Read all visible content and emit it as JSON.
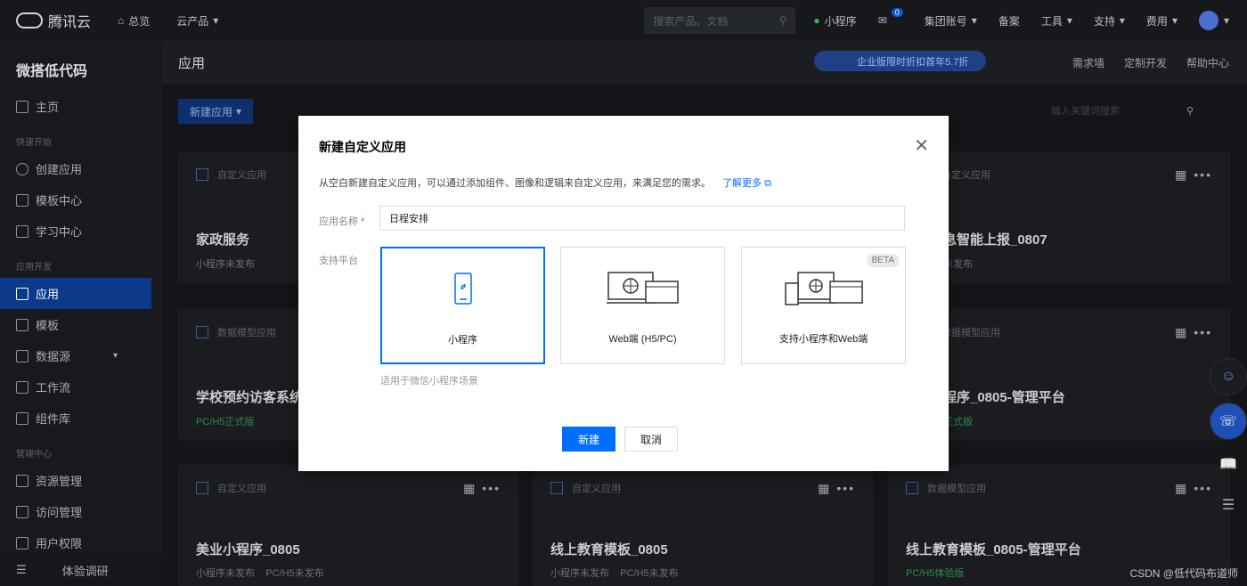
{
  "topbar": {
    "brand": "腾讯云",
    "overview": "总览",
    "products": "云产品",
    "search_placeholder": "搜索产品、文档",
    "mini_program": "小程序",
    "msg_count": "0",
    "account": "集团账号",
    "beian": "备案",
    "tools": "工具",
    "support": "支持",
    "cost": "费用"
  },
  "sidebar": {
    "title": "微搭低代码",
    "home": "主页",
    "group_quick": "快速开始",
    "create_app": "创建应用",
    "template_center": "模板中心",
    "learning": "学习中心",
    "group_app_dev": "应用开发",
    "apps": "应用",
    "templates": "模板",
    "datasource": "数据源",
    "workflow": "工作流",
    "components": "组件库",
    "group_manage": "管理中心",
    "resources": "资源管理",
    "access": "访问管理",
    "user_perm": "用户权限",
    "survey": "体验调研"
  },
  "main": {
    "title": "应用",
    "promo": "企业版限时折扣首年5.7折",
    "links": [
      "需求墙",
      "定制开发",
      "帮助中心"
    ],
    "new_app": "新建应用",
    "filter_placeholder": "输入关键词搜索"
  },
  "cards": [
    {
      "type": "自定义应用",
      "name": "家政服务",
      "status": "小程序未发布"
    },
    {
      "type": "自定义应用",
      "name": "息智能上报_0807",
      "status": "未发布"
    },
    {
      "type": "数据模型应用",
      "name": "学校预约访客系统",
      "status": "PC/H5正式版"
    },
    {
      "type": "数据模型应用",
      "name": "程序_0805-管理平台",
      "status": "正式版"
    },
    {
      "type": "自定义应用",
      "name": "美业小程序_0805",
      "status": "小程序未发布",
      "status2": "PC/H5未发布"
    },
    {
      "type": "自定义应用",
      "name": "线上教育模板_0805",
      "status": "小程序未发布",
      "status2": "PC/H5未发布"
    },
    {
      "type": "数据模型应用",
      "name": "线上教育模板_0805-管理平台",
      "status": "PC/H5体验版"
    }
  ],
  "modal": {
    "title": "新建自定义应用",
    "desc": "从空白新建自定义应用，可以通过添加组件、图像和逻辑来自定义应用，来满足您的需求。",
    "learn_more": "了解更多",
    "name_label": "应用名称",
    "name_value": "日程安排",
    "platform_label": "支持平台",
    "platforms": [
      "小程序",
      "Web端 (H5/PC)",
      "支持小程序和Web端"
    ],
    "beta": "BETA",
    "hint": "适用于微信小程序场景",
    "ok": "新建",
    "cancel": "取消"
  },
  "watermark": "CSDN @低代码布道师"
}
